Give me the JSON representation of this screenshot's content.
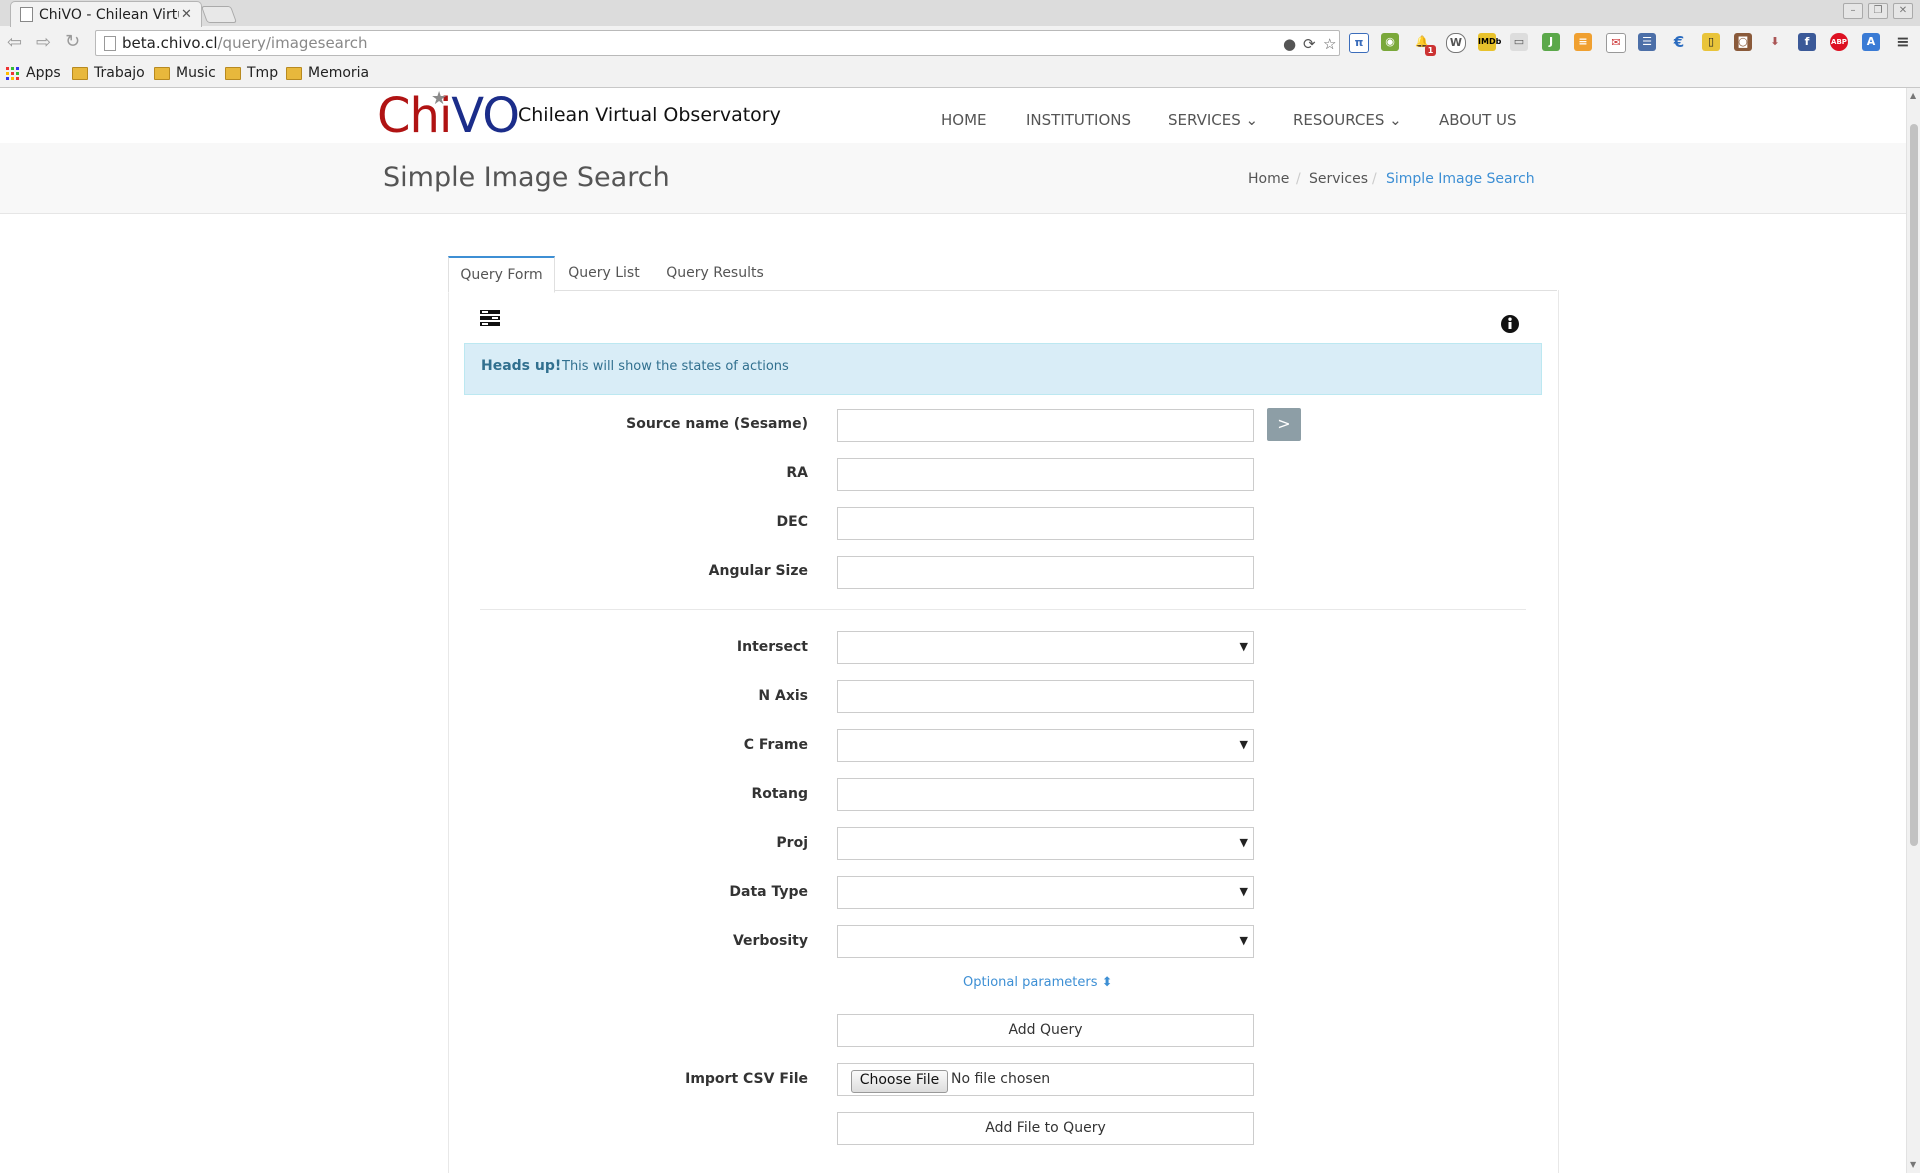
{
  "browser": {
    "tab_title": "ChiVO - Chilean Virtu",
    "url_host": "beta.chivo.cl",
    "url_path": "/query/imagesearch",
    "bookmarks": [
      "Apps",
      "Trabajo",
      "Music",
      "Tmp",
      "Memoria"
    ],
    "extensions": [
      "lightbulb-icon",
      "refresh-icon",
      "star-icon",
      "pi-icon",
      "fruit-icon",
      "bell-icon",
      "wordpress-icon",
      "imdb-icon",
      "scanner-icon",
      "rubber-stamp-icon",
      "rss-icon",
      "gmail-icon",
      "document-icon",
      "euro-icon",
      "phone-icon",
      "instagram-icon",
      "download-icon",
      "facebook-icon",
      "adblock-icon",
      "translate-icon",
      "menu-icon"
    ],
    "notification_count": "1"
  },
  "site": {
    "logo_chi": "Chi",
    "logo_vo": "VO",
    "name": "Chilean Virtual Observatory",
    "nav": [
      "HOME",
      "INSTITUTIONS",
      "SERVICES",
      "RESOURCES",
      "ABOUT US"
    ],
    "nav_caret": "⌄"
  },
  "header": {
    "title": "Simple Image Search",
    "breadcrumb": [
      "Home",
      "Services",
      "Simple Image Search"
    ]
  },
  "tabs": [
    "Query Form",
    "Query List",
    "Query Results"
  ],
  "alert": {
    "bold": "Heads up!",
    "text": "This will show the states of actions"
  },
  "form": {
    "source_name_label": "Source name (Sesame)",
    "ra_label": "RA",
    "dec_label": "DEC",
    "angular_size_label": "Angular Size",
    "intersect_label": "Intersect",
    "naxis_label": "N Axis",
    "cframe_label": "C Frame",
    "rotang_label": "Rotang",
    "proj_label": "Proj",
    "datatype_label": "Data Type",
    "verbosity_label": "Verbosity",
    "go_symbol": ">",
    "optional_parameters": "Optional parameters",
    "add_query": "Add Query",
    "import_csv_label": "Import CSV File",
    "choose_file": "Choose File",
    "no_file": "No file chosen",
    "add_file_to_query": "Add File to Query"
  },
  "colors": {
    "logo_red": "#b01313",
    "logo_blue": "#1b2d8a",
    "link_blue": "#3d8fd4",
    "alert_bg": "#d9edf7",
    "alert_text": "#31708f"
  }
}
